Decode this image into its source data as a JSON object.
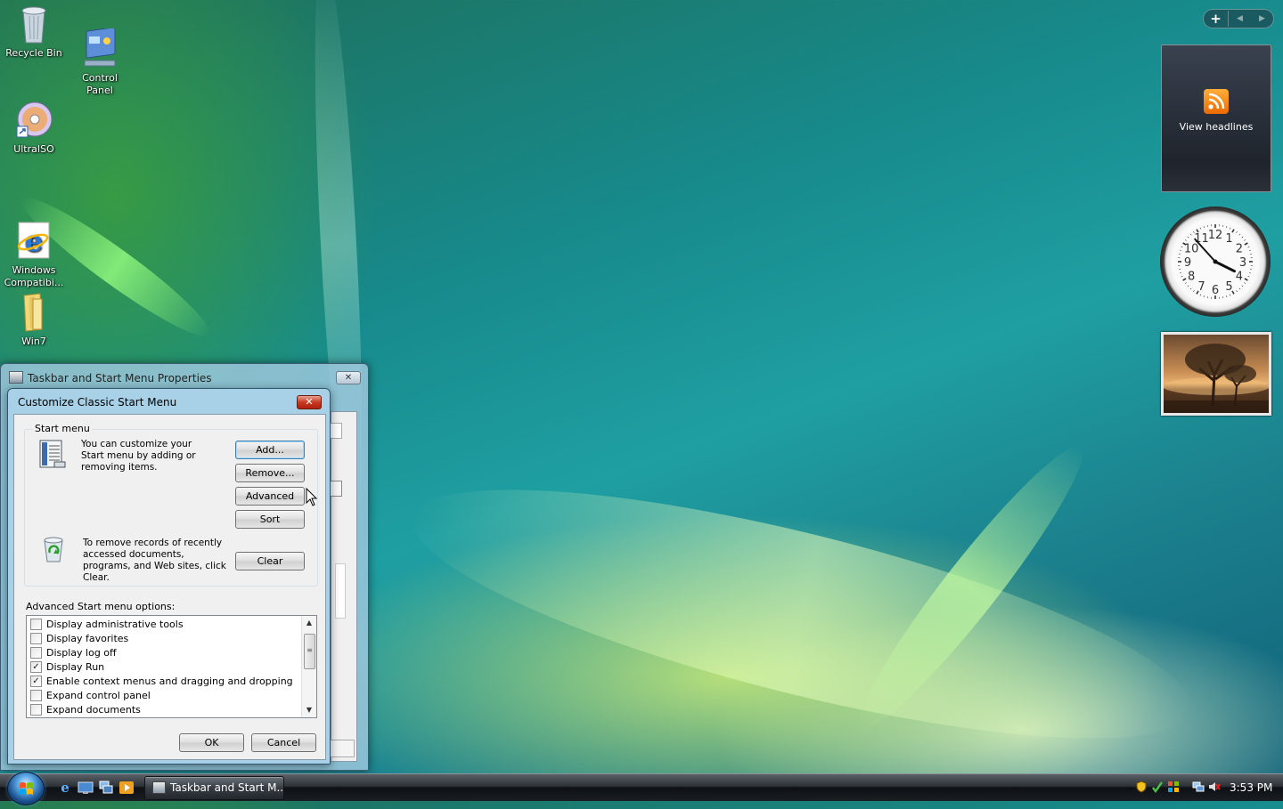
{
  "desktop": {
    "icons": [
      {
        "label": "Recycle Bin"
      },
      {
        "label": "Control\nPanel"
      },
      {
        "label": "UltraISO"
      },
      {
        "label": "Windows\nCompatibi..."
      },
      {
        "label": "Win7"
      }
    ]
  },
  "gadgets": {
    "feed_text": "View headlines",
    "clock_numbers": [
      "12",
      "1",
      "2",
      "3",
      "4",
      "5",
      "6",
      "7",
      "8",
      "9",
      "10",
      "11"
    ],
    "clock_time": {
      "hour": 3,
      "minute": 53
    }
  },
  "outer_window": {
    "title": "Taskbar and Start Menu Properties"
  },
  "dialog": {
    "title": "Customize Classic Start Menu",
    "close_glyph": "✕",
    "start_menu_group": {
      "label": "Start menu",
      "description": "You can customize your Start menu by adding or removing items.",
      "buttons": {
        "add": "Add...",
        "remove": "Remove...",
        "advanced": "Advanced",
        "sort": "Sort"
      },
      "clear_description": "To remove records of recently accessed documents, programs, and Web sites, click Clear.",
      "clear": "Clear"
    },
    "advanced_label": "Advanced Start menu options:",
    "options": [
      {
        "label": "Display administrative tools",
        "checked": false
      },
      {
        "label": "Display favorites",
        "checked": false
      },
      {
        "label": "Display log off",
        "checked": false
      },
      {
        "label": "Display Run",
        "checked": true
      },
      {
        "label": "Enable context menus and dragging and dropping",
        "checked": true
      },
      {
        "label": "Expand control panel",
        "checked": false
      },
      {
        "label": "Expand documents",
        "checked": false
      }
    ],
    "ok": "OK",
    "cancel": "Cancel"
  },
  "taskbar": {
    "task_button": "Taskbar and Start M...",
    "time": "3:53 PM"
  }
}
